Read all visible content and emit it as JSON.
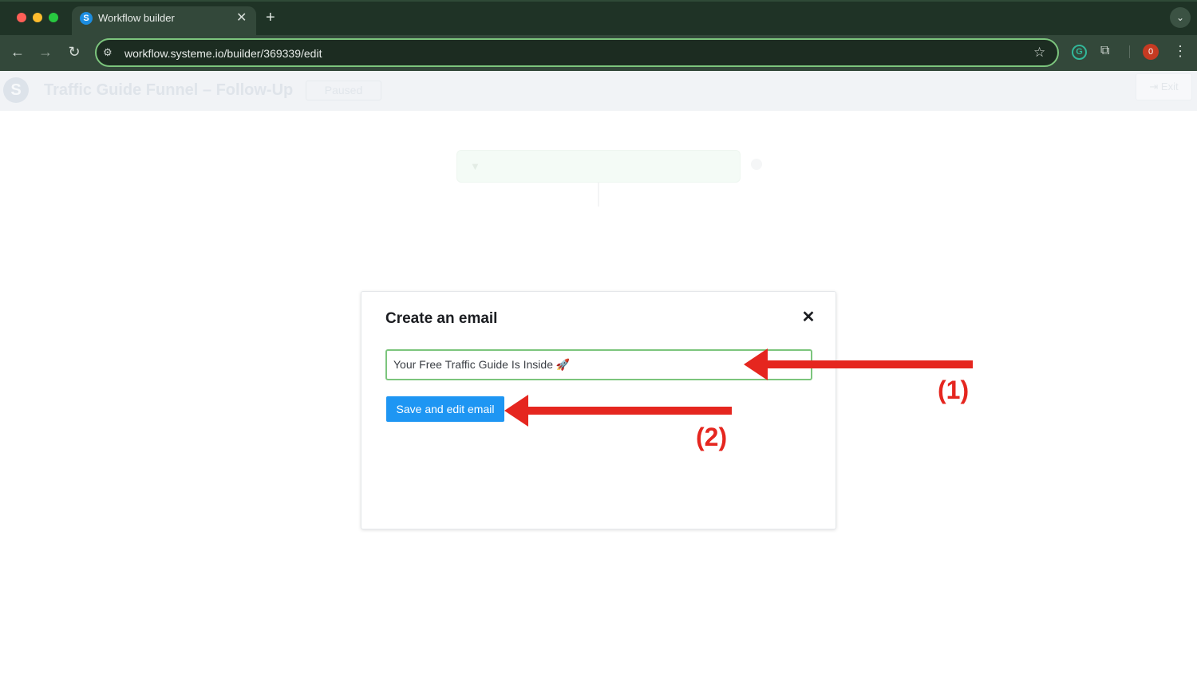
{
  "browser": {
    "tab_title": "Workflow builder",
    "tab_favicon_letter": "S",
    "tab_close": "✕",
    "new_tab": "+",
    "tab_menu": "⌄",
    "url": "workflow.systeme.io/builder/369339/edit",
    "profile_initial": "0"
  },
  "app": {
    "logo_letter": "S",
    "workflow_title": "Traffic Guide Funnel – Follow-Up",
    "status": "Paused",
    "exit_label": "Exit"
  },
  "modal": {
    "title": "Create an email",
    "close": "✕",
    "subject_value": "Your Free Traffic Guide Is Inside 🚀",
    "save_label": "Save and edit email"
  },
  "annotations": {
    "label_1": "(1)",
    "label_2": "(2)",
    "color": "#e5261f"
  },
  "colors": {
    "chrome_dark": "#1f3326",
    "chrome_toolbar": "#33483a",
    "focus_green": "#7cc57d",
    "primary_blue": "#1e96f3"
  }
}
